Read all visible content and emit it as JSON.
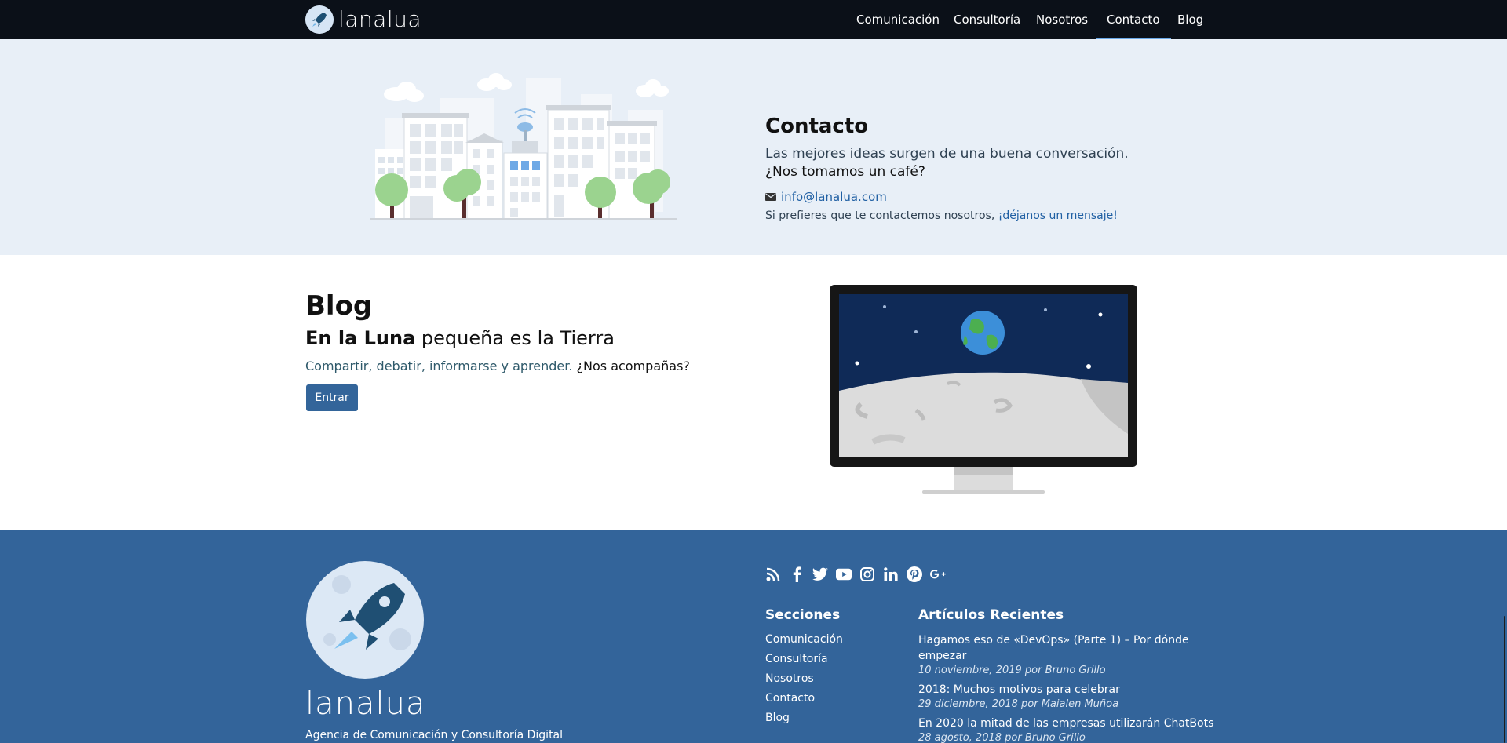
{
  "navbar": {
    "brand": "lanalua",
    "items": [
      {
        "label": "Comunicación"
      },
      {
        "label": "Consultoría"
      },
      {
        "label": "Nosotros"
      },
      {
        "label": "Contacto"
      },
      {
        "label": "Blog"
      }
    ],
    "active_index": 3
  },
  "contact": {
    "title": "Contacto",
    "line1": "Las mejores ideas surgen de una buena conversación.",
    "line2": "¿Nos tomamos un café?",
    "email": "info@lanalua.com",
    "note_prefix": "Si prefieres que te contactemos nosotros, ",
    "note_link": "¡déjanos un mensaje!"
  },
  "blog": {
    "title": "Blog",
    "subtitle_bold": "En la Luna",
    "subtitle_rest": " pequeña es la Tierra",
    "desc": "Compartir, debatir, informarse y aprender. ",
    "desc_q": "¿Nos acompañas?",
    "button": "Entrar"
  },
  "footer": {
    "wordmark": "lanalua",
    "tagline": "Agencia de Comunicación y Consultoría Digital",
    "social_icons": [
      "rss-icon",
      "facebook-icon",
      "twitter-icon",
      "youtube-icon",
      "instagram-icon",
      "linkedin-icon",
      "pinterest-icon",
      "google-plus-icon"
    ],
    "sections_title": "Secciones",
    "sections": [
      "Comunicación",
      "Consultoría",
      "Nosotros",
      "Contacto",
      "Blog"
    ],
    "articles_title": "Artículos Recientes",
    "articles": [
      {
        "title": "Hagamos eso de «DevOps» (Parte 1) – Por dónde empezar",
        "meta": "10 noviembre, 2019 por Bruno Grillo"
      },
      {
        "title": "2018: Muchos motivos para celebrar",
        "meta": "29 diciembre, 2018 por Maialen Muñoa"
      },
      {
        "title": "En 2020 la mitad de las empresas utilizarán ChatBots",
        "meta": "28 agosto, 2018 por Bruno Grillo"
      }
    ]
  },
  "colors": {
    "navbar_bg": "#0b1018",
    "contact_bg": "#e8eff7",
    "footer_bg": "#33649a",
    "accent": "#33659a",
    "link": "#1f5fa3"
  }
}
